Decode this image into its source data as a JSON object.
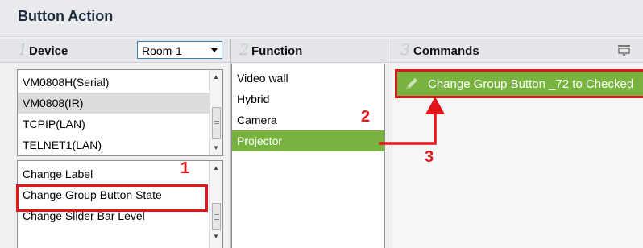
{
  "title": "Button Action",
  "columns": {
    "device": {
      "number": "1",
      "label": "Device"
    },
    "function": {
      "number": "2",
      "label": "Function"
    },
    "commands": {
      "number": "3",
      "label": "Commands"
    }
  },
  "room_dropdown": {
    "selected": "Room-1"
  },
  "device_list": {
    "items": [
      "VM0808H(Serial)",
      "VM0808(IR)",
      "TCPIP(LAN)",
      "TELNET1(LAN)"
    ],
    "selected": "VM0808(IR)"
  },
  "action_list": {
    "items": [
      "Change Label",
      "Change Group Button State",
      "Change Slider Bar Level"
    ],
    "selected": "Change Group Button State"
  },
  "function_list": {
    "items": [
      "Video wall",
      "Hybrid",
      "Camera",
      "Projector"
    ],
    "selected": "Projector"
  },
  "commands_list": {
    "items": [
      "Change Group Button _72 to Checked"
    ]
  },
  "callouts": [
    "1",
    "2",
    "3"
  ],
  "colors": {
    "accent_green": "#78b23f",
    "callout_red": "#e0161b"
  },
  "icons": {
    "commands_header": "screen-icon",
    "command_item": "pencil-icon"
  }
}
